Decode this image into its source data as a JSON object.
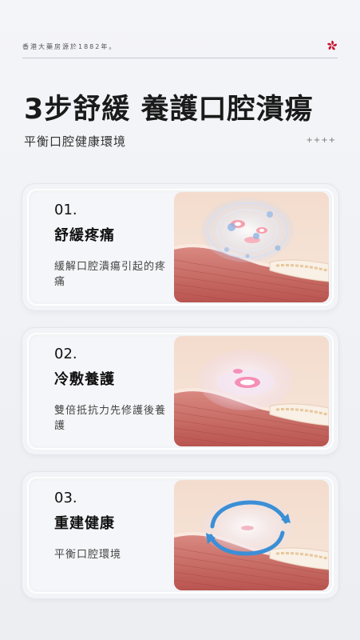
{
  "header": {
    "since_text": "香港大藥房源於1882年。",
    "headline": "3步舒緩 養護口腔潰瘍",
    "subheadline": "平衡口腔健康環境",
    "decor_text": "++++"
  },
  "steps": [
    {
      "number": "01.",
      "title": "舒緩疼痛",
      "desc": "緩解口腔潰瘍引起的疼痛",
      "illustration": "ulcer-with-bubbles-icon"
    },
    {
      "number": "02.",
      "title": "冷敷養護",
      "desc": "雙倍抵抗力先修護後養護",
      "illustration": "ulcer-covered-film-icon"
    },
    {
      "number": "03.",
      "title": "重建健康",
      "desc": "平衡口腔環境",
      "illustration": "cycle-arrows-icon"
    }
  ],
  "colors": {
    "accent_red": "#c8102e",
    "arrow_blue": "#3b8fd6",
    "tissue_pink": "#e9a6a0"
  }
}
